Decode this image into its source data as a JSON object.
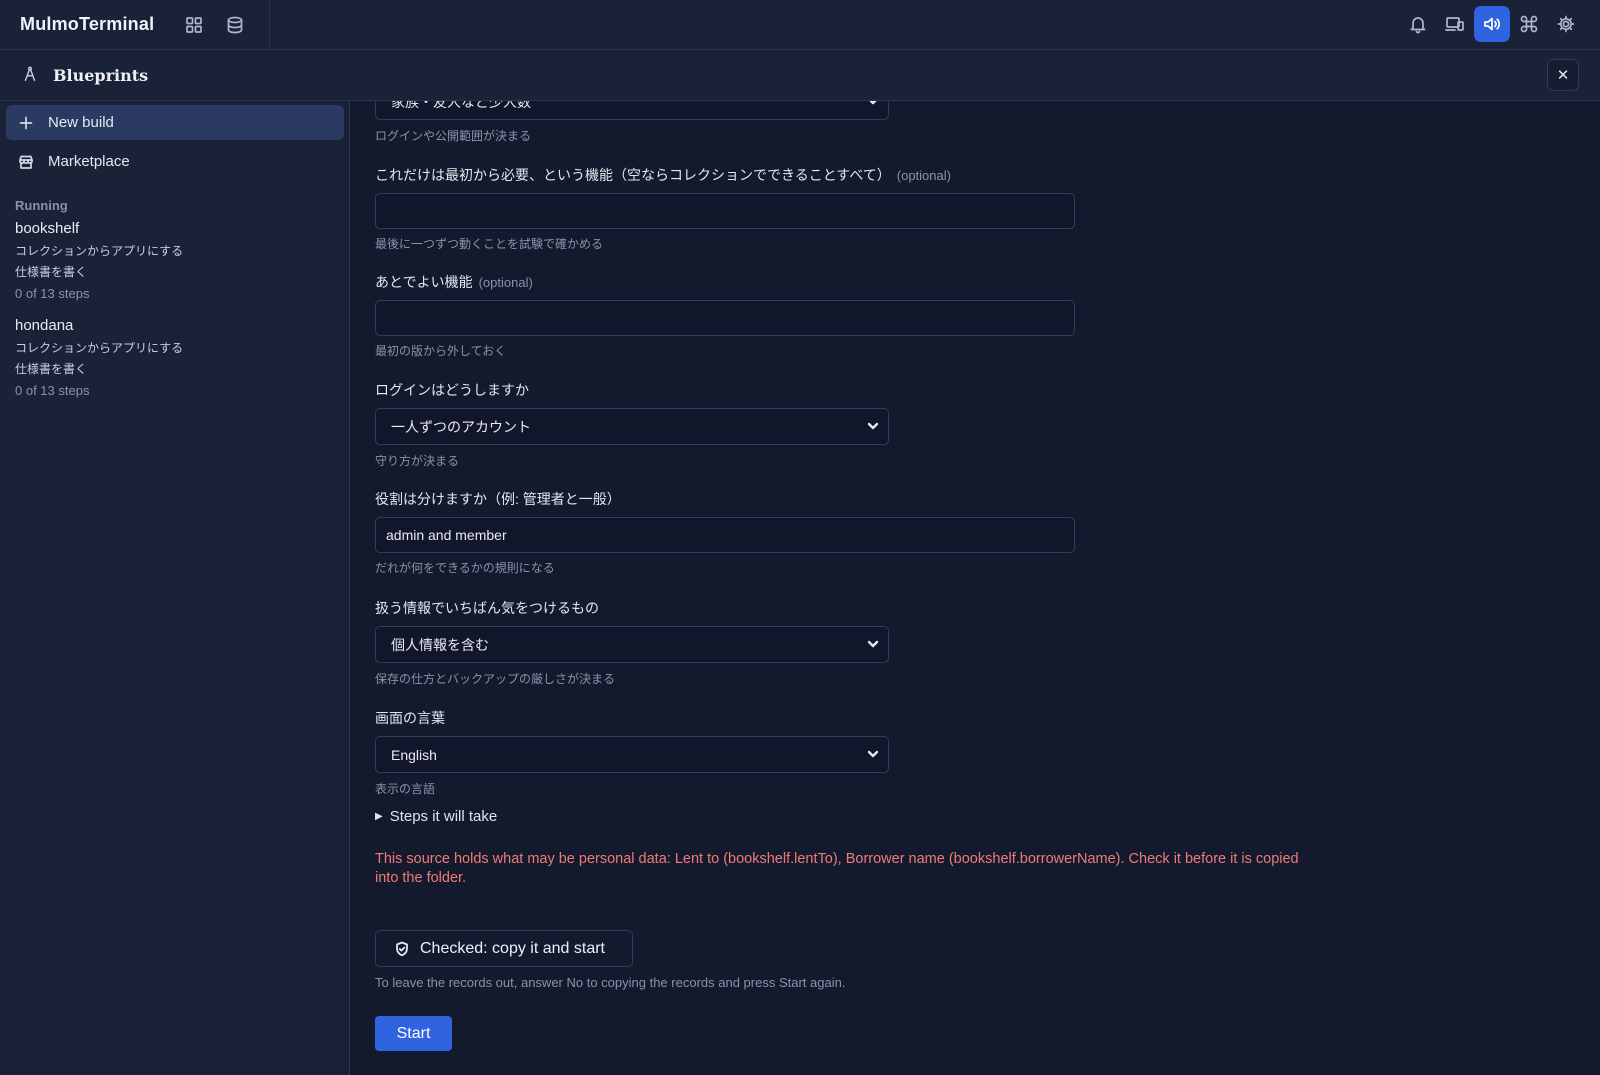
{
  "app": {
    "title": "MulmoTerminal"
  },
  "topbar": {
    "left_icons": [
      "grid-icon",
      "database-icon"
    ],
    "right_icons": [
      "bell-icon",
      "devices-icon",
      "speaker-icon",
      "command-icon",
      "gear-icon"
    ],
    "active_icon": "speaker-icon",
    "accent": "#2f63e0"
  },
  "subheader": {
    "title": "Blueprints",
    "close_label": "✕"
  },
  "sidebar": {
    "new_build": "New build",
    "marketplace": "Marketplace",
    "running_label": "Running",
    "running": [
      {
        "name": "bookshelf",
        "line1": "コレクションからアプリにする",
        "line2": "仕様書を書く",
        "steps": "0 of 13 steps"
      },
      {
        "name": "hondana",
        "line1": "コレクションからアプリにする",
        "line2": "仕様書を書く",
        "steps": "0 of 13 steps"
      }
    ]
  },
  "form": {
    "top_select_value": "家族・友人など少人数",
    "top_hint": "ログインや公開範囲が決まる",
    "must_have": {
      "label": "これだけは最初から必要、という機能（空ならコレクションでできることすべて）",
      "optional": "(optional)",
      "value": "",
      "hint": "最後に一つずつ動くことを試験で確かめる"
    },
    "later": {
      "label": "あとでよい機能",
      "optional": "(optional)",
      "value": "",
      "hint": "最初の版から外しておく"
    },
    "login": {
      "label": "ログインはどうしますか",
      "value": "一人ずつのアカウント",
      "hint": "守り方が決まる"
    },
    "roles": {
      "label": "役割は分けますか（例: 管理者と一般）",
      "value": "admin and member",
      "hint": "だれが何をできるかの規則になる"
    },
    "sensitive": {
      "label": "扱う情報でいちばん気をつけるもの",
      "value": "個人情報を含む",
      "hint": "保存の仕方とバックアップの厳しさが決まる"
    },
    "language": {
      "label": "画面の言葉",
      "value": "English",
      "hint": "表示の言語"
    },
    "steps_toggle": "Steps it will take",
    "warning": "This source holds what may be personal data: Lent to (bookshelf.lentTo), Borrower name (bookshelf.borrowerName). Check it before it is copied into the folder.",
    "check_button": "Checked: copy it and start",
    "leave_note": "To leave the records out, answer No to copying the records and press Start again.",
    "start_button": "Start"
  },
  "colors": {
    "warning": "#f07a75",
    "primary": "#2f63e0"
  }
}
